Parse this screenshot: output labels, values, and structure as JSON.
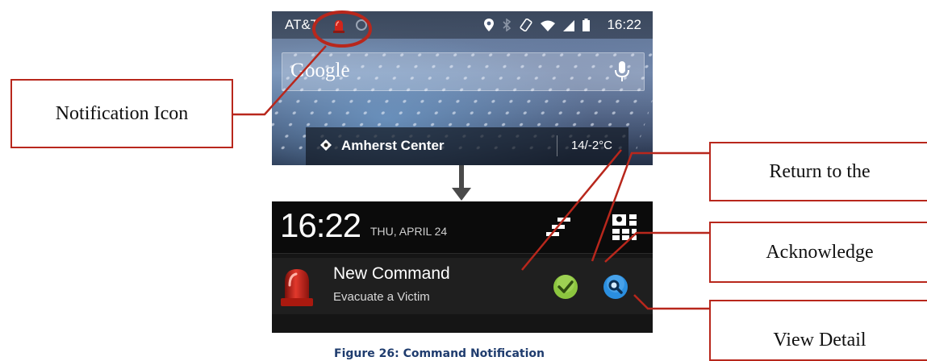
{
  "status_bar": {
    "carrier": "AT&T",
    "time": "16:22"
  },
  "search_bar": {
    "logo_text": "Google"
  },
  "weather_widget": {
    "location": "Amherst Center",
    "temperature": "14/-2°C"
  },
  "notification_shade": {
    "time": "16:22",
    "date": "THU, APRIL 24",
    "notification": {
      "title": "New Command",
      "text": "Evacuate a Victim"
    }
  },
  "callouts": {
    "notification_icon": "Notification Icon",
    "return_to_app": "Return to the",
    "acknowledge": "Acknowledge",
    "view_detail": "View Detail"
  },
  "caption": "Figure 26: Command Notification",
  "colors": {
    "callout_red": "#b8271c",
    "caption_blue": "#1f3c6e",
    "ack_green": "#8cc63f",
    "view_blue": "#2b8fe0",
    "siren_red": "#d0251b"
  }
}
